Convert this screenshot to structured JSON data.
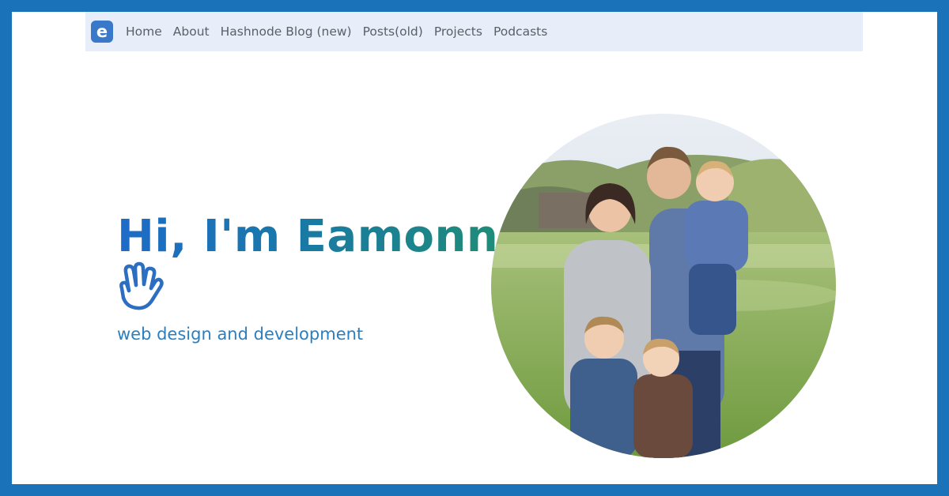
{
  "nav": {
    "logo_letter": "e",
    "items": [
      {
        "label": "Home"
      },
      {
        "label": "About"
      },
      {
        "label": "Hashnode Blog (new)"
      },
      {
        "label": "Posts(old)"
      },
      {
        "label": "Projects"
      },
      {
        "label": "Podcasts"
      }
    ]
  },
  "hero": {
    "title": "Hi, I'm Eamonn",
    "tagline": "web design and development",
    "wave_icon": "waving-hand-icon",
    "photo_icon": "family-photo"
  },
  "colors": {
    "frame": "#1a73b8",
    "navbar_bg": "#e8eef9",
    "title_gradient_start": "#1e6cc8",
    "title_gradient_end": "#1f8c78",
    "tagline": "#2a7fc0"
  }
}
